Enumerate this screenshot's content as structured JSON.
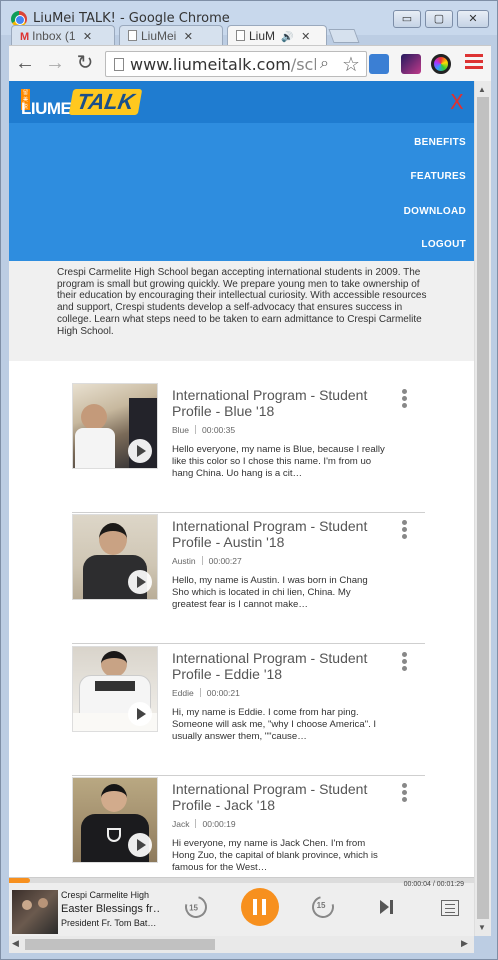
{
  "window": {
    "title": "LiuMei TALK! - Google Chrome",
    "minimize": "▭",
    "maximize": "▢",
    "close": "✕"
  },
  "tabs": [
    {
      "label": "Inbox (1",
      "close": "✕"
    },
    {
      "label": "LiuMei",
      "close": "✕"
    },
    {
      "label": "LiuM",
      "close": "✕"
    }
  ],
  "toolbar": {
    "url_host": "www.liumeitalk.com",
    "url_path": "/schoo"
  },
  "site": {
    "logo_small": "留美说",
    "logo_brand": "LIUMEI",
    "logo_talk": "TALK",
    "close_label": "X",
    "menu": [
      "BENEFITS",
      "FEATURES",
      "DOWNLOAD",
      "LOGOUT"
    ],
    "about": "Crespi Carmelite High School began accepting international students in 2009. The program is small but growing quickly. We prepare young men to take ownership of their education by encouraging their intellectual curiosity. With accessible resources and support, Crespi students develop a self-advocacy that ensures success in college. Learn what steps need to be taken to earn admittance to Crespi Carmelite High School."
  },
  "videos": [
    {
      "title": "International Program - Student Profile - Blue '18",
      "speaker": "Blue",
      "duration": "00:00:35",
      "description": "Hello everyone, my name is Blue, because I really like this color so I chose this name.  I'm from uo hang China.  Uo hang is a cit…"
    },
    {
      "title": "International Program - Student Profile - Austin '18",
      "speaker": "Austin",
      "duration": "00:00:27",
      "description": "Hello, my name is Austin.  I was born in Chang Sho which is located in chi lien, China.  My greatest fear is I cannot make…"
    },
    {
      "title": "International Program - Student Profile - Eddie '18",
      "speaker": "Eddie",
      "duration": "00:00:21",
      "description": "Hi, my name is Eddie.  I come from har ping.  Someone will ask me, \"why I choose America\".  I usually answer them, \"\"cause…"
    },
    {
      "title": "International Program - Student Profile - Jack '18",
      "speaker": "Jack",
      "duration": "00:00:19",
      "description": "Hi everyone, my name is Jack Chen.  I'm from Hong Zuo, the capital of blank province, which is famous for the West…"
    }
  ],
  "player": {
    "school": "Crespi Carmelite High",
    "title": "Easter Blessings fr…",
    "subtitle": "President Fr. Tom Bat…",
    "time": "00:00:04 / 00:01:29",
    "progress": 0.045,
    "skip_back": "15",
    "skip_forward": "15",
    "accent": "#f7901e"
  },
  "colors": {
    "header_blue": "#2e8ddf",
    "header_dark": "#1f7cd0",
    "about_bg": "#f0f0f0"
  }
}
